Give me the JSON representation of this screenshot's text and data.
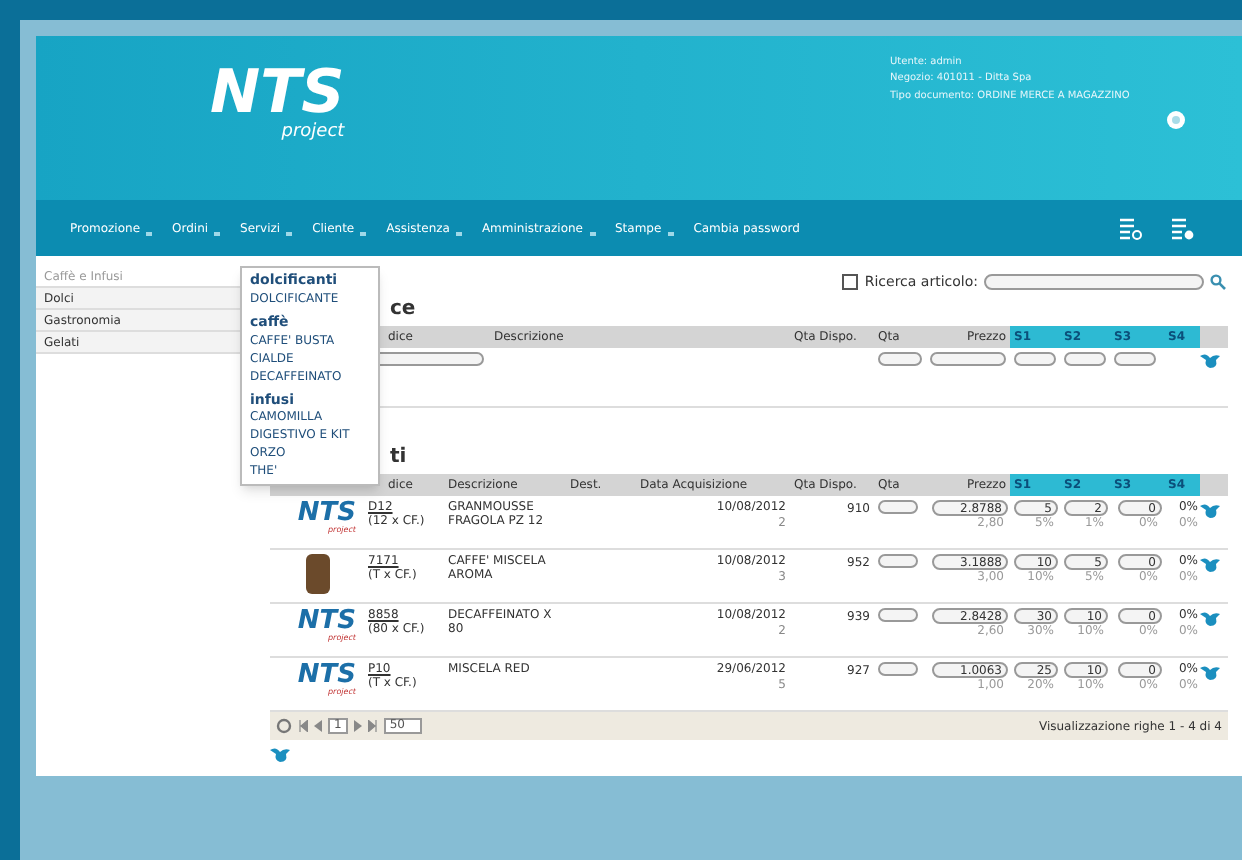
{
  "header": {
    "logo": {
      "main": "NTS",
      "sub": "project"
    },
    "info_lines": [
      "Utente: admin",
      "Negozio: 401011 - Ditta Spa",
      "Tipo documento: ORDINE MERCE A MAGAZZINO"
    ]
  },
  "nav": {
    "items": [
      "Promozione",
      "Ordini",
      "Servizi",
      "Cliente",
      "Assistenza",
      "Amministrazione",
      "Stampe",
      "Cambia password"
    ],
    "dropdown_flags": [
      true,
      true,
      true,
      true,
      true,
      true,
      true,
      false
    ]
  },
  "sidebar": {
    "items": [
      {
        "label": "Caffè e Infusi",
        "selected": true
      },
      {
        "label": "Dolci",
        "selected": false
      },
      {
        "label": "Gastronomia",
        "selected": false
      },
      {
        "label": "Gelati",
        "selected": false
      }
    ]
  },
  "dropdown": {
    "groups": [
      {
        "title": "dolcificanti",
        "items": [
          "DOLCIFICANTE"
        ]
      },
      {
        "title": "caffè",
        "items": [
          "CAFFE' BUSTA",
          "CIALDE",
          "DECAFFEINATO"
        ]
      },
      {
        "title": "infusi",
        "items": [
          "CAMOMILLA",
          "DIGESTIVO E KIT",
          "ORZO",
          "THE'"
        ]
      }
    ]
  },
  "search": {
    "checked": false,
    "label": "Ricerca articolo:"
  },
  "quick_table": {
    "title": "ce",
    "columns": [
      "dice",
      "Descrizione",
      "Qta Dispo.",
      "Qta",
      "Prezzo",
      "S1",
      "S2",
      "S3",
      "S4"
    ]
  },
  "articles": {
    "title": "ti",
    "columns": [
      "dice",
      "Descrizione",
      "Dest.",
      "Data Acquisizione",
      "Qta Dispo.",
      "Qta",
      "Prezzo",
      "S1",
      "S2",
      "S3",
      "S4"
    ],
    "rows": [
      {
        "image": {
          "kind": "logo",
          "main": "NTS",
          "sub": "project"
        },
        "code": "D12",
        "code_sub": "(12 x CF.)",
        "description": "GRANMOUSSE FRAGOLA PZ 12",
        "date": "10/08/2012",
        "date_sub": "2",
        "qty_available": "910",
        "price": "2.8788",
        "price_sub": "2,80",
        "discounts": [
          {
            "value": "5",
            "pct": "5%"
          },
          {
            "value": "2",
            "pct": "1%"
          },
          {
            "value": "0",
            "pct": "0%"
          }
        ],
        "s4": "0%",
        "s4_sub": "0%"
      },
      {
        "image": {
          "kind": "photo"
        },
        "code": "7171",
        "code_sub": "(T x CF.)",
        "description": "CAFFE' MISCELA AROMA",
        "date": "10/08/2012",
        "date_sub": "3",
        "qty_available": "952",
        "price": "3.1888",
        "price_sub": "3,00",
        "discounts": [
          {
            "value": "10",
            "pct": "10%"
          },
          {
            "value": "5",
            "pct": "5%"
          },
          {
            "value": "0",
            "pct": "0%"
          }
        ],
        "s4": "0%",
        "s4_sub": "0%"
      },
      {
        "image": {
          "kind": "logo",
          "main": "NTS",
          "sub": "project"
        },
        "code": "8858",
        "code_sub": "(80 x CF.)",
        "description": "DECAFFEINATO X 80",
        "date": "10/08/2012",
        "date_sub": "2",
        "qty_available": "939",
        "price": "2.8428",
        "price_sub": "2,60",
        "discounts": [
          {
            "value": "30",
            "pct": "30%"
          },
          {
            "value": "10",
            "pct": "10%"
          },
          {
            "value": "0",
            "pct": "0%"
          }
        ],
        "s4": "0%",
        "s4_sub": "0%"
      },
      {
        "image": {
          "kind": "logo",
          "main": "NTS",
          "sub": "project"
        },
        "code": "P10",
        "code_sub": "(T x CF.)",
        "description": "MISCELA RED",
        "date": "29/06/2012",
        "date_sub": "5",
        "qty_available": "927",
        "price": "1.0063",
        "price_sub": "1,00",
        "discounts": [
          {
            "value": "25",
            "pct": "20%"
          },
          {
            "value": "10",
            "pct": "10%"
          },
          {
            "value": "0",
            "pct": "0%"
          }
        ],
        "s4": "0%",
        "s4_sub": "0%"
      }
    ]
  },
  "pager": {
    "page": "1",
    "page_size": "50"
  },
  "status": "Visualizzazione righe 1 - 4 di 4"
}
